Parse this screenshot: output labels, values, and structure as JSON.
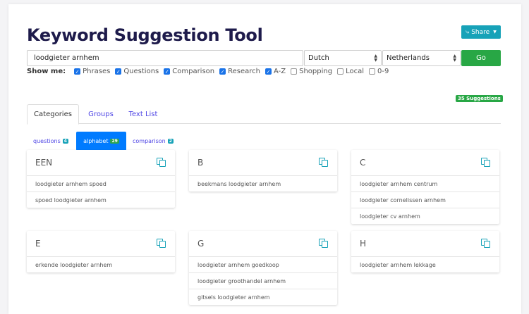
{
  "header": {
    "title": "Keyword Suggestion Tool",
    "share_label": "Share"
  },
  "search": {
    "query": "loodgieter arnhem",
    "language": "Dutch",
    "country": "Netherlands",
    "go_label": "Go"
  },
  "show_me": {
    "label": "Show me:",
    "options": [
      {
        "label": "Phrases",
        "checked": true
      },
      {
        "label": "Questions",
        "checked": true
      },
      {
        "label": "Comparison",
        "checked": true
      },
      {
        "label": "Research",
        "checked": true
      },
      {
        "label": "A-Z",
        "checked": true
      },
      {
        "label": "Shopping",
        "checked": false
      },
      {
        "label": "Local",
        "checked": false
      },
      {
        "label": "0-9",
        "checked": false
      }
    ]
  },
  "suggestions_badge": "35 Suggestions",
  "tabs": [
    {
      "label": "Categories"
    },
    {
      "label": "Groups"
    },
    {
      "label": "Text List"
    }
  ],
  "subtabs": [
    {
      "label": "questions",
      "count": "4"
    },
    {
      "label": "alphabet",
      "count": "29"
    },
    {
      "label": "comparison",
      "count": "2"
    }
  ],
  "cards": [
    {
      "heading": "EEN",
      "items": [
        "loodgieter arnhem spoed",
        "spoed loodgieter arnhem"
      ]
    },
    {
      "heading": "B",
      "items": [
        "beekmans loodgieter arnhem"
      ]
    },
    {
      "heading": "C",
      "items": [
        "loodgieter arnhem centrum",
        "loodgieter cornelissen arnhem",
        "loodgieter cv arnhem"
      ]
    },
    {
      "heading": "E",
      "items": [
        "erkende loodgieter arnhem"
      ]
    },
    {
      "heading": "G",
      "items": [
        "loodgieter arnhem goedkoop",
        "loodgieter groothandel arnhem",
        "gitsels loodgieter arnhem"
      ]
    },
    {
      "heading": "H",
      "items": [
        "loodgieter arnhem lekkage"
      ]
    }
  ],
  "colors": {
    "accent": "#17a2b8",
    "go": "#28a745",
    "active_subtab": "#007bff",
    "title": "#1e1b4b"
  }
}
